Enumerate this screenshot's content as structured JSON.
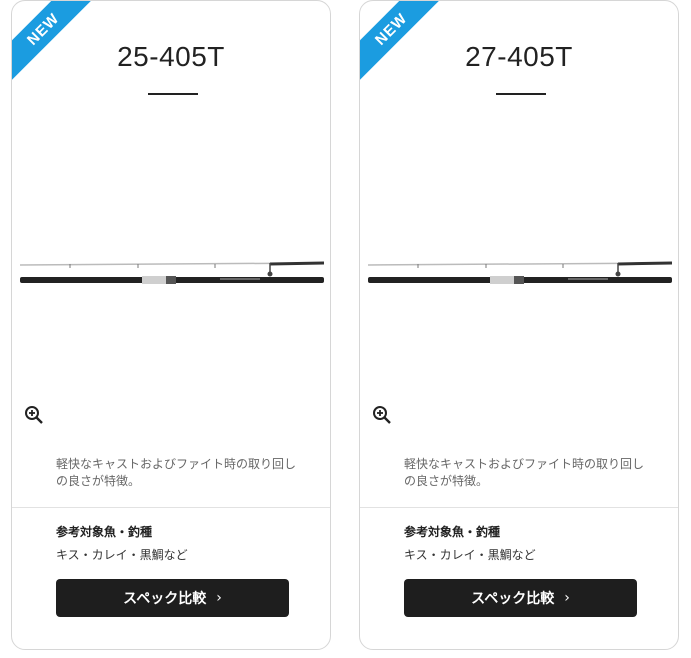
{
  "products": [
    {
      "badge": "NEW",
      "model": "25-405T",
      "description": "軽快なキャストおよびファイト時の取り回しの良さが特徴。",
      "target_label": "参考対象魚・釣種",
      "target_fish": "キス・カレイ・黒鯛など",
      "compare_label": "スペック比較",
      "compare_icon": "chevron-right-icon"
    },
    {
      "badge": "NEW",
      "model": "27-405T",
      "description": "軽快なキャストおよびファイト時の取り回しの良さが特徴。",
      "target_label": "参考対象魚・釣種",
      "target_fish": "キス・カレイ・黒鯛など",
      "compare_label": "スペック比較",
      "compare_icon": "chevron-right-icon"
    }
  ],
  "colors": {
    "badge": "#1b9ce0",
    "button": "#1e1e1e",
    "border": "#d6d6d6"
  },
  "icons": {
    "zoom": "zoom-in-icon"
  }
}
